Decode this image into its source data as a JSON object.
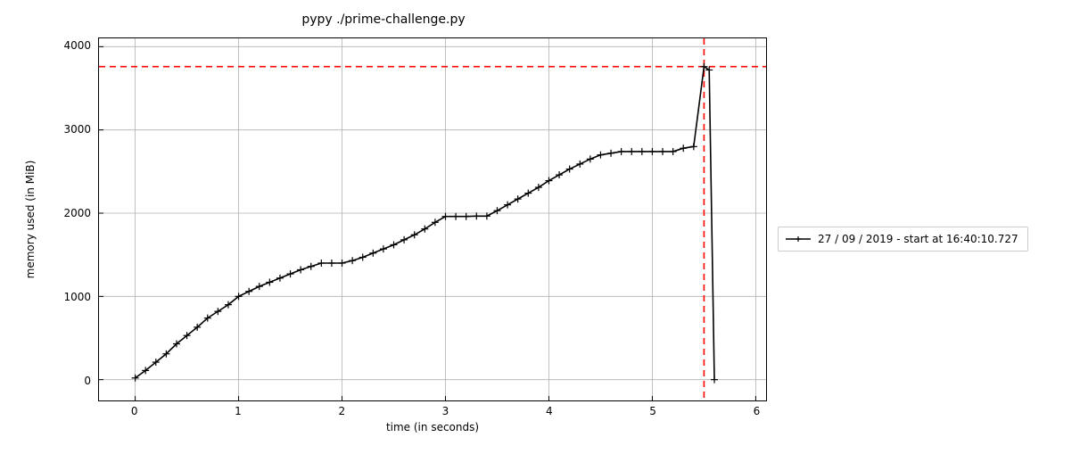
{
  "chart_data": {
    "type": "line",
    "title": "pypy ./prime-challenge.py",
    "xlabel": "time (in seconds)",
    "ylabel": "memory used (in MiB)",
    "xlim": [
      -0.35,
      6.1
    ],
    "ylim": [
      -250,
      4100
    ],
    "xticks": [
      0,
      1,
      2,
      3,
      4,
      5,
      6
    ],
    "yticks": [
      0,
      1000,
      2000,
      3000,
      4000
    ],
    "grid": true,
    "legend_position": "right-outside",
    "series": [
      {
        "name": "27 / 09 / 2019 - start at 16:40:10.727",
        "color": "#000000",
        "marker": "+",
        "x": [
          0.0,
          0.1,
          0.2,
          0.3,
          0.4,
          0.5,
          0.6,
          0.7,
          0.8,
          0.9,
          1.0,
          1.1,
          1.2,
          1.3,
          1.4,
          1.5,
          1.6,
          1.7,
          1.8,
          1.9,
          2.0,
          2.1,
          2.2,
          2.3,
          2.4,
          2.5,
          2.6,
          2.7,
          2.8,
          2.9,
          3.0,
          3.1,
          3.2,
          3.3,
          3.4,
          3.5,
          3.6,
          3.7,
          3.8,
          3.9,
          4.0,
          4.1,
          4.2,
          4.3,
          4.4,
          4.5,
          4.6,
          4.7,
          4.8,
          4.9,
          5.0,
          5.1,
          5.2,
          5.3,
          5.4,
          5.5,
          5.55,
          5.6
        ],
        "y": [
          20,
          110,
          210,
          310,
          430,
          530,
          630,
          740,
          820,
          900,
          1000,
          1060,
          1120,
          1170,
          1220,
          1270,
          1320,
          1360,
          1400,
          1400,
          1400,
          1430,
          1470,
          1520,
          1570,
          1620,
          1680,
          1740,
          1810,
          1890,
          1960,
          1960,
          1960,
          1965,
          1965,
          2030,
          2100,
          2170,
          2240,
          2310,
          2390,
          2460,
          2530,
          2590,
          2650,
          2700,
          2720,
          2740,
          2740,
          2740,
          2740,
          2740,
          2740,
          2780,
          2800,
          3760,
          3720,
          0
        ]
      }
    ],
    "annotations": {
      "hline_y": 3760,
      "vline_x": 5.5,
      "hline_color": "#ff0000",
      "vline_color": "#ff0000",
      "line_style": "dashed"
    }
  }
}
